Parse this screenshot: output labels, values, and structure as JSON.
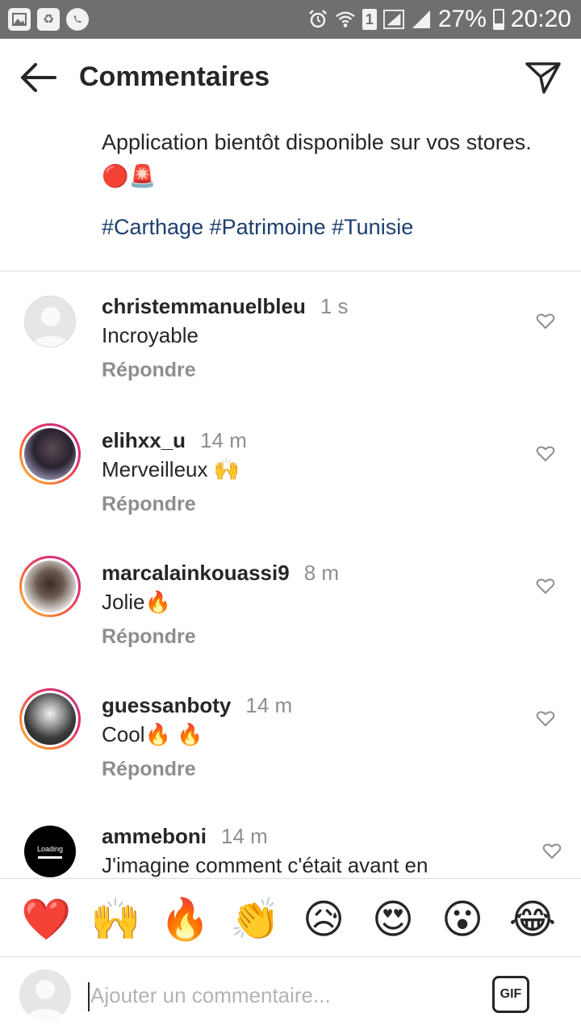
{
  "status_bar": {
    "battery": "27%",
    "time": "20:20",
    "sim_slot": "1",
    "left_icons": [
      "gallery-icon",
      "recycle-icon",
      "whatsapp-icon"
    ],
    "right_icons": [
      "alarm-icon",
      "wifi-icon",
      "sim-icon",
      "signal-icon",
      "signal-icon",
      "battery-icon"
    ],
    "battery_level": 0.27
  },
  "header": {
    "title": "Commentaires",
    "back_icon": "arrow-left-icon",
    "send_icon": "paper-plane-icon"
  },
  "post": {
    "caption": "Application bientôt disponible sur vos stores.",
    "caption_emojis": "🔴🚨",
    "hashtags": "#Carthage #Patrimoine #Tunisie"
  },
  "comments": [
    {
      "username": "christemmanuelbleu",
      "time": "1 s",
      "text": "Incroyable",
      "reply": "Répondre",
      "avatar": "default"
    },
    {
      "username": "elihxx_u",
      "time": "14 m",
      "text": "Merveilleux 🙌",
      "reply": "Répondre",
      "avatar": "story-ring"
    },
    {
      "username": "marcalainkouassi9",
      "time": "8 m",
      "text": "Jolie🔥",
      "reply": "Répondre",
      "avatar": "story-ring"
    },
    {
      "username": "guessanboty",
      "time": "14 m",
      "text": "Cool🔥 🔥",
      "reply": "Répondre",
      "avatar": "story-ring"
    },
    {
      "username": "ammeboni",
      "time": "14 m",
      "text": "J'imagine comment c'était avant en",
      "reply": "",
      "avatar": "loading",
      "avatar_text": "Loading"
    }
  ],
  "reactions": [
    "❤️",
    "🙌",
    "🔥",
    "👏",
    "😥",
    "😍",
    "😮",
    "😂"
  ],
  "input": {
    "placeholder": "Ajouter un commentaire...",
    "gif_label": "GIF"
  },
  "colors": {
    "hashtag": "#1d3f6e",
    "secondary_text": "#8e8e8e",
    "status_bar": "#6f6f6f"
  }
}
